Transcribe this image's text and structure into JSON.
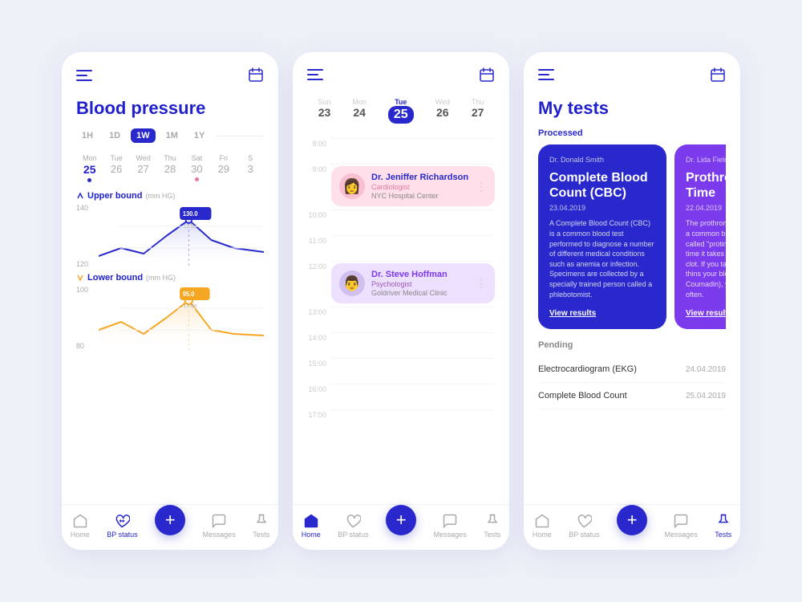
{
  "screen1": {
    "title": "Blood pressure",
    "timeTabs": [
      "1H",
      "1D",
      "1W",
      "1M",
      "1Y"
    ],
    "activeTab": "1W",
    "weekDays": [
      {
        "name": "Mon",
        "num": "25",
        "dot": "blue"
      },
      {
        "name": "Tue",
        "num": "26",
        "dot": null
      },
      {
        "name": "Wed",
        "num": "27",
        "dot": null
      },
      {
        "name": "Thu",
        "num": "28",
        "dot": null
      },
      {
        "name": "Sat",
        "num": "30",
        "dot": "pink"
      },
      {
        "name": "Fri",
        "num": "29",
        "dot": null
      },
      {
        "name": "S",
        "num": "3",
        "dot": null
      }
    ],
    "upperBound": {
      "label": "Upper bound",
      "unit": "(mm HG)",
      "peak": "130.0",
      "peakTime": "12:53",
      "yLabels": [
        "140",
        "120"
      ]
    },
    "lowerBound": {
      "label": "Lower bound",
      "unit": "(mm HG)",
      "peak": "95.0",
      "peakTime": "12:53",
      "yLabels": [
        "100",
        "80"
      ]
    }
  },
  "screen2": {
    "calDays": [
      {
        "name": "Sun",
        "num": "23",
        "dots": []
      },
      {
        "name": "Mon",
        "num": "24",
        "dots": [
          "blue"
        ]
      },
      {
        "name": "Tue",
        "num": "25",
        "dots": [
          "pink",
          "pink"
        ],
        "active": true
      },
      {
        "name": "Wed",
        "num": "26",
        "dots": []
      },
      {
        "name": "Thu",
        "num": "27",
        "dots": [
          "orange"
        ]
      }
    ],
    "timeSlots": [
      "8:00",
      "9:00",
      "10:00",
      "11:00",
      "12:00",
      "13:00",
      "14:00",
      "15:00",
      "16:00",
      "17:00"
    ],
    "appointments": [
      {
        "slot": "9:00",
        "name": "Dr. Jeniffer Richardson",
        "specialty": "Cardiologist",
        "location": "NYC Hospital Center",
        "type": "pink",
        "avatar": "👩"
      },
      {
        "slot": "12:00",
        "name": "Dr. Steve Hoffman",
        "specialty": "Psychologist",
        "location": "Goldriver Medical Clinic",
        "type": "purple",
        "avatar": "👨"
      }
    ]
  },
  "screen3": {
    "title": "My tests",
    "processedLabel": "Processed",
    "cards": [
      {
        "type": "blue",
        "doctorName": "Dr. Donald Smith",
        "testTitle": "Complete Blood Count (CBC)",
        "date": "23.04.2019",
        "description": "A Complete Blood Count (CBC) is a common blood test performed to diagnose a number of different medical conditions such as anemia or infection. Specimens are collected by a specially trained person called a phlebotomist.",
        "viewResults": "View results"
      },
      {
        "type": "purple",
        "doctorName": "Dr. Lida Fields",
        "testTitle": "Prothrombin Time",
        "date": "22.04.2019",
        "description": "The prothrombin time (PT test) is a common blood test. It's also called \"protime\". It measures the time it takes for your blood to clot. If you take medicine that thins your blood (such as Coumadin), you will have a test often.",
        "viewResults": "View results"
      }
    ],
    "pendingLabel": "Pending",
    "pendingItems": [
      {
        "name": "Electrocardiogram (EKG)",
        "date": "24.04.2019"
      },
      {
        "name": "Complete Blood Count",
        "date": "25.04.2019"
      }
    ]
  },
  "nav": {
    "items": [
      {
        "label": "Home",
        "icon": "home"
      },
      {
        "label": "BP status",
        "icon": "heart"
      },
      {
        "label": "plus",
        "icon": "plus"
      },
      {
        "label": "Messages",
        "icon": "messages"
      },
      {
        "label": "Tests",
        "icon": "tests"
      }
    ]
  }
}
